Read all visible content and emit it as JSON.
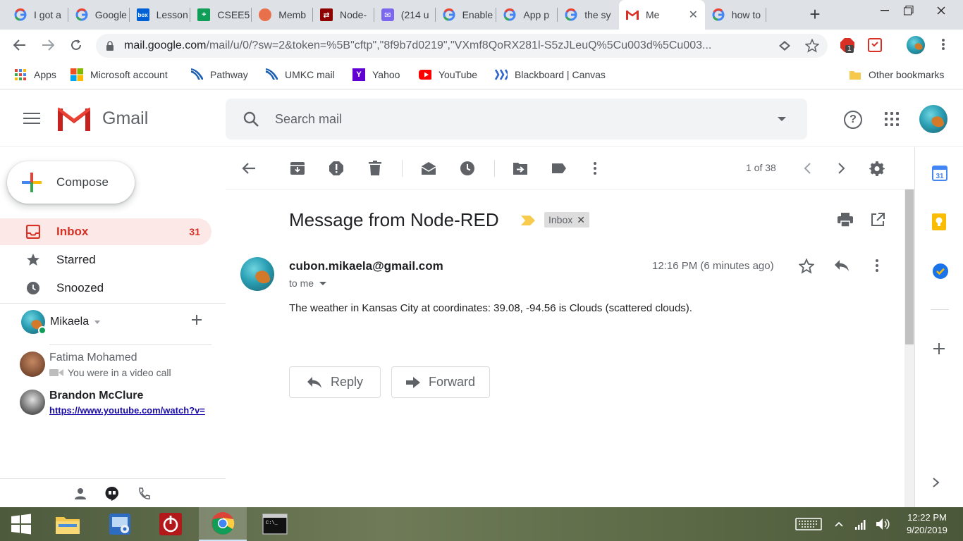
{
  "browser": {
    "tabs": [
      {
        "title": "I got a",
        "favicon": "google-icon",
        "color": "#4285f4"
      },
      {
        "title": "Google",
        "favicon": "google-icon",
        "color": "#4285f4"
      },
      {
        "title": "Lesson",
        "favicon": "box-icon",
        "color": "#0061d5"
      },
      {
        "title": "CSEE5",
        "favicon": "sheets-icon",
        "color": "#0f9d58"
      },
      {
        "title": "Memb",
        "favicon": "shell-icon",
        "color": "#e8704a"
      },
      {
        "title": "Node-",
        "favicon": "nodered-icon",
        "color": "#8f0000"
      },
      {
        "title": "(214 u",
        "favicon": "mail-icon",
        "color": "#7b68ee"
      },
      {
        "title": "Enable",
        "favicon": "google-icon",
        "color": "#4285f4"
      },
      {
        "title": "App p",
        "favicon": "google-icon",
        "color": "#4285f4"
      },
      {
        "title": "the sy",
        "favicon": "google-icon",
        "color": "#4285f4"
      },
      {
        "title": "Me",
        "favicon": "gmail-icon",
        "color": "#d93025"
      },
      {
        "title": "how to",
        "favicon": "google-icon",
        "color": "#4285f4"
      }
    ],
    "url_host": "mail.google.com",
    "url_rest": "/mail/u/0/?sw=2&token=%5B\"cftp\",\"8f9b7d0219\",\"VXmf8QoRX281l-S5zJLeuQ%5Cu003d%5Cu003...",
    "extension_badge": "1",
    "bookmarks": [
      {
        "label": "Apps",
        "icon": "apps-grid-icon",
        "color": "#4285f4"
      },
      {
        "label": "Microsoft account",
        "icon": "microsoft-icon",
        "color": "#f25022"
      },
      {
        "label": "Pathway",
        "icon": "pathway-icon",
        "color": "#1a5fb4"
      },
      {
        "label": "UMKC mail",
        "icon": "umkc-icon",
        "color": "#1a5fb4"
      },
      {
        "label": "Yahoo",
        "icon": "yahoo-icon",
        "color": "#6001d2"
      },
      {
        "label": "YouTube",
        "icon": "youtube-icon",
        "color": "#ff0000"
      },
      {
        "label": "Blackboard | Canvas",
        "icon": "blackboard-icon",
        "color": "#2f64cc"
      }
    ],
    "other_bookmarks": "Other bookmarks"
  },
  "gmail": {
    "logo_text": "Gmail",
    "search_placeholder": "Search mail",
    "compose_label": "Compose",
    "nav": [
      {
        "label": "Inbox",
        "count": "31",
        "icon": "inbox-icon",
        "active": true
      },
      {
        "label": "Starred",
        "count": "",
        "icon": "star-icon",
        "active": false
      },
      {
        "label": "Snoozed",
        "count": "",
        "icon": "clock-icon",
        "active": false
      }
    ],
    "hangouts": {
      "user": "Mikaela",
      "contacts": [
        {
          "name": "Fatima Mohamed",
          "status": "You were in a video call"
        },
        {
          "name": "Brandon McClure",
          "status": "https://www.youtube.com/watch?v="
        }
      ]
    },
    "pager": "1 of 38",
    "message": {
      "subject": "Message from Node-RED",
      "label": "Inbox",
      "sender": "cubon.mikaela@gmail.com",
      "to": "to me",
      "time": "12:16 PM (6 minutes ago)",
      "body": "The weather in Kansas City at coordinates: 39.08, -94.56 is Clouds (scattered clouds).",
      "reply_label": "Reply",
      "forward_label": "Forward"
    }
  },
  "taskbar": {
    "time": "12:22 PM",
    "date": "9/20/2019"
  },
  "colors": {
    "accent_red": "#d93025",
    "inbox_bg": "#fce8e6",
    "chrome_strip": "#dee1e6"
  }
}
